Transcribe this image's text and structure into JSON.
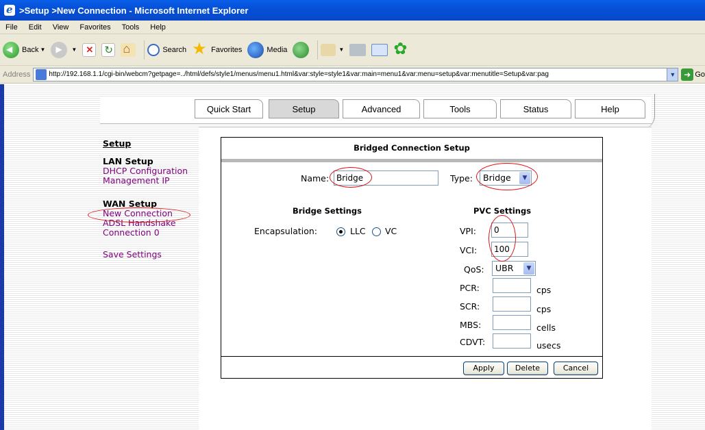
{
  "window": {
    "title": ">Setup >New Connection - Microsoft Internet Explorer"
  },
  "menu": [
    "File",
    "Edit",
    "View",
    "Favorites",
    "Tools",
    "Help"
  ],
  "toolbar": {
    "back_label": "Back",
    "search_label": "Search",
    "favorites_label": "Favorites",
    "media_label": "Media"
  },
  "address": {
    "label": "Address",
    "url": "http://192.168.1.1/cgi-bin/webcm?getpage=../html/defs/style1/menus/menu1.html&var:style=style1&var:main=menu1&var:menu=setup&var:menutitle=Setup&var:pag",
    "go_label": "Go"
  },
  "nav_tabs": [
    "Quick Start",
    "Setup",
    "Advanced",
    "Tools",
    "Status",
    "Help"
  ],
  "sidebar": {
    "heading": "Setup",
    "lan_title": "LAN Setup",
    "lan_links": [
      "DHCP Configuration",
      "Management IP"
    ],
    "wan_title": "WAN Setup",
    "wan_links": [
      "New Connection",
      "ADSL Handshake",
      "Connection 0"
    ],
    "save_link": "Save Settings"
  },
  "form": {
    "title": "Bridged Connection Setup",
    "name_label": "Name:",
    "name_value": "Bridge",
    "type_label": "Type:",
    "type_value": "Bridge",
    "bridge_settings_title": "Bridge Settings",
    "encapsulation_label": "Encapsulation:",
    "encap_options": [
      "LLC",
      "VC"
    ],
    "encap_selected": "LLC",
    "pvc_settings_title": "PVC Settings",
    "vpi_label": "VPI:",
    "vpi_value": "0",
    "vci_label": "VCI:",
    "vci_value": "100",
    "qos_label": "QoS:",
    "qos_value": "UBR",
    "pcr_label": "PCR:",
    "pcr_unit": "cps",
    "scr_label": "SCR:",
    "scr_unit": "cps",
    "mbs_label": "MBS:",
    "mbs_unit": "cells",
    "cdvt_label": "CDVT:",
    "cdvt_unit": "usecs",
    "buttons": [
      "Apply",
      "Delete",
      "Cancel"
    ]
  },
  "colors": {
    "titlebar": "#0550d8",
    "link_visited": "#800080",
    "annotation": "#e01010"
  }
}
